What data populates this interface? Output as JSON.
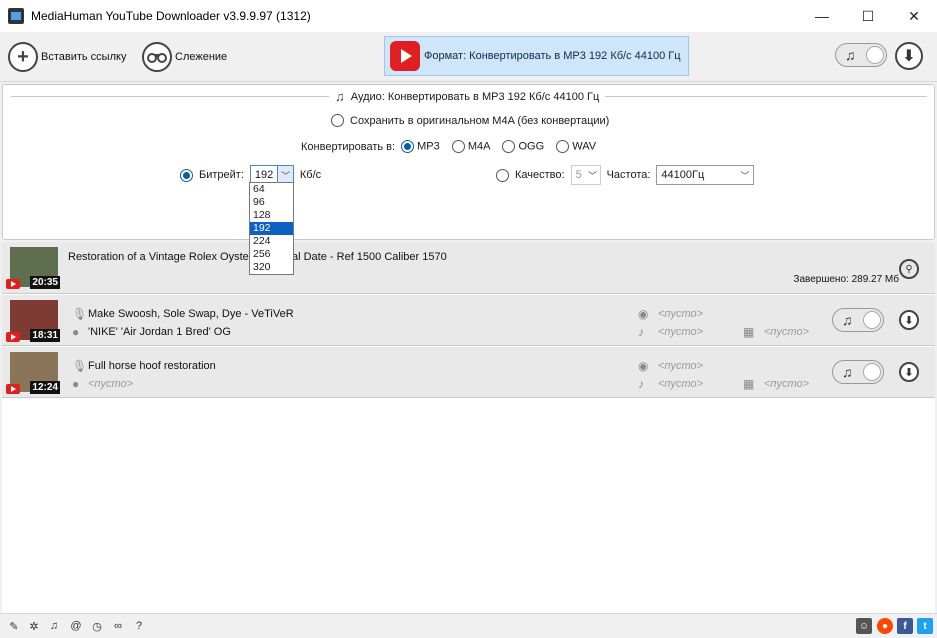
{
  "window": {
    "title": "MediaHuman YouTube Downloader v3.9.9.97 (1312)",
    "minimize": "—",
    "maximize": "☐",
    "close": "✕"
  },
  "toolbar": {
    "paste_label": "Вставить ссылку",
    "tracking_label": "Слежение",
    "format_label": "Формат: Конвертировать в MP3 192 Кб/с 44100 Гц",
    "download_all": "⬇"
  },
  "settings": {
    "header": "Аудио: Конвертировать в MP3 192 Кб/с 44100 Гц",
    "keep_original": "Сохранить в оригинальном M4A (без конвертации)",
    "convert_to_label": "Конвертировать в:",
    "formats": [
      "MP3",
      "M4A",
      "OGG",
      "WAV"
    ],
    "selected_format": "MP3",
    "bitrate_label": "Битрейт:",
    "bitrate_value": "192",
    "bitrate_unit": "Кб/с",
    "bitrate_options": [
      "64",
      "96",
      "128",
      "192",
      "224",
      "256",
      "320"
    ],
    "quality_label": "Качество:",
    "quality_value": "5",
    "frequency_label": "Частота:",
    "frequency_value": "44100Гц"
  },
  "items": [
    {
      "title": "Restoration of a Vintage Rolex Oyster",
      "title_rest": "al Date - Ref 1500 Caliber 1570",
      "duration": "20:35",
      "status": "Завершено: 289.27 Мб"
    },
    {
      "title": "Make Swoosh, Sole Swap, Dye - VeTiVeR",
      "artist": "'NIKE' 'Air Jordan 1 Bred' OG",
      "duration": "18:31",
      "album": "<пусто>",
      "genre": "<пусто>",
      "year": "<пусто>"
    },
    {
      "title": "Full horse hoof restoration",
      "artist": "<пусто>",
      "duration": "12:24",
      "album": "<пусто>",
      "genre": "<пусто>",
      "year": "<пусто>"
    }
  ],
  "statusbar": {
    "help": "?"
  }
}
